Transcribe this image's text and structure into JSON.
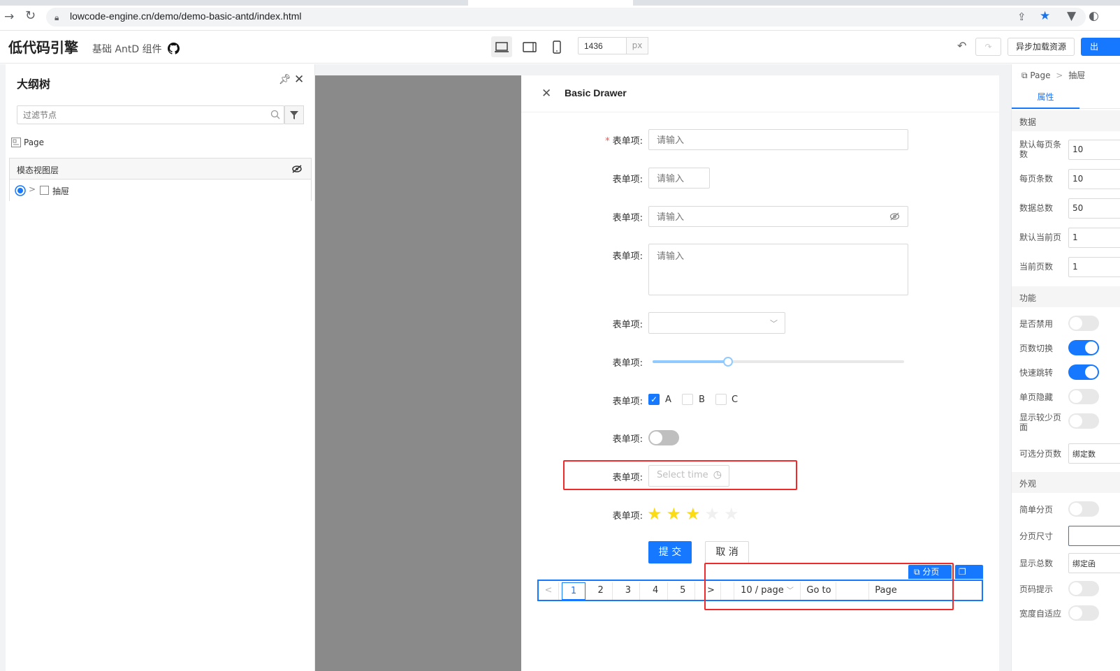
{
  "browser": {
    "url": "lowcode-engine.cn/demo/demo-basic-antd/index.html"
  },
  "header": {
    "brand": "低代码引擎",
    "subtitle": "基础 AntD 组件",
    "width_value": "1436",
    "width_unit": "px",
    "async_load_label": "异步加载资源",
    "primary_label_partial": "出"
  },
  "outline": {
    "title": "大纲树",
    "filter_placeholder": "过滤节点",
    "root_label": "Page",
    "modal_layer_label": "模态视图层",
    "drawer_label": "抽屉"
  },
  "drawer": {
    "title": "Basic Drawer",
    "form_label": "表单项",
    "label_colon": ":",
    "placeholder": "请输入",
    "time_placeholder": "Select time",
    "checkboxes": [
      "A",
      "B",
      "C"
    ],
    "slider_value": 0.3,
    "rate_value": 3,
    "rate_max": 5,
    "submit_label": "提 交",
    "cancel_label": "取 消"
  },
  "pagination": {
    "tag_label": "分页",
    "pages": [
      "1",
      "2",
      "3",
      "4",
      "5"
    ],
    "current_page": "1",
    "page_size": "10 / page",
    "goto_label": "Go to",
    "page_label": "Page"
  },
  "props_panel": {
    "breadcrumb_root": "Page",
    "breadcrumb_current": "抽屉",
    "tab_label": "属性",
    "sections": {
      "data": "数据",
      "feature": "功能",
      "appearance": "外观"
    },
    "data_props": [
      {
        "label": "默认每页条数",
        "value": "10"
      },
      {
        "label": "每页条数",
        "value": "10"
      },
      {
        "label": "数据总数",
        "value": "50"
      },
      {
        "label": "默认当前页",
        "value": "1"
      },
      {
        "label": "当前页数",
        "value": "1"
      }
    ],
    "feature_props": [
      {
        "label": "是否禁用",
        "on": false
      },
      {
        "label": "页数切换",
        "on": true
      },
      {
        "label": "快速跳转",
        "on": true
      },
      {
        "label": "单页隐藏",
        "on": false
      },
      {
        "label": "显示较少页面",
        "on": false
      }
    ],
    "selectable_pages_label": "可选分页数",
    "selectable_pages_value": "绑定数",
    "appearance_props": {
      "simple_label": "简单分页",
      "size_label": "分页尺寸",
      "show_total_label": "显示总数",
      "show_total_value": "绑定函",
      "tip_label": "页码提示",
      "responsive_label": "宽度自适应"
    }
  },
  "colors": {
    "primary": "#1677ff",
    "highlight": "#f02a2a",
    "star": "#fadb14",
    "mask": "#8a8a8a"
  }
}
